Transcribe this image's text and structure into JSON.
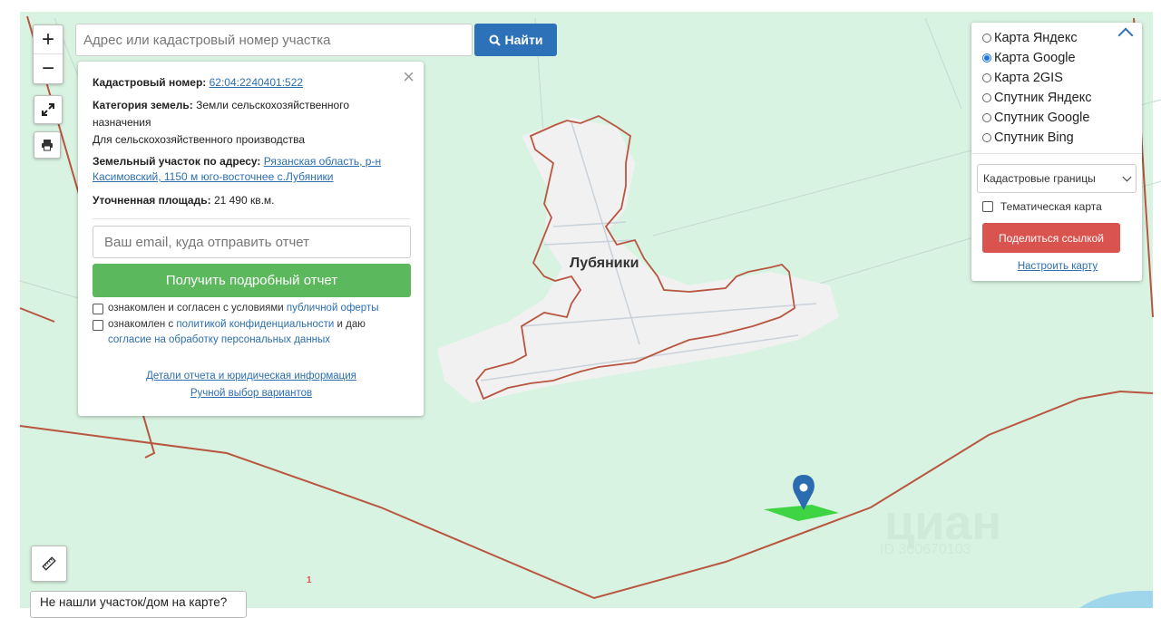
{
  "map": {
    "town_label": "Лубяники",
    "watermark": "циан",
    "watermark_id": "ID 300670103",
    "small_marker": "1"
  },
  "controls": {
    "zoom_in": "+",
    "zoom_out": "−"
  },
  "search": {
    "placeholder": "Адрес или кадастровый номер участка",
    "button_label": "Найти"
  },
  "info": {
    "cadastral_label": "Кадастровый номер:",
    "cadastral_number": "62:04:2240401:522",
    "category_label": "Категория земель:",
    "category_value": "Земли сельскохозяйственного назначения",
    "usage": "Для сельскохозяйственного производства",
    "address_label": "Земельный участок по адресу:",
    "address_value": "Рязанская область, р-н Касимовский, 1150 м юго-восточнее с.Лубяники",
    "area_label": "Уточненная площадь:",
    "area_value": "21 490 кв.м.",
    "email_placeholder": "Ваш email, куда отправить отчет",
    "report_button": "Получить подробный отчет",
    "offer_text": "ознакомлен и согласен с условиями",
    "offer_link": "публичной оферты",
    "privacy_text_1": "ознакомлен с",
    "privacy_link": "политикой конфиденциальности",
    "privacy_text_2": "и даю",
    "consent_link": "согласие на обработку персональных данных",
    "details_link": "Детали отчета и юридическая информация",
    "manual_link": "Ручной выбор вариантов"
  },
  "layers": {
    "options": [
      {
        "label": "Карта Яндекс",
        "selected": false
      },
      {
        "label": "Карта Google",
        "selected": true
      },
      {
        "label": "Карта 2GIS",
        "selected": false
      },
      {
        "label": "Спутник Яндекс",
        "selected": false
      },
      {
        "label": "Спутник Google",
        "selected": false
      },
      {
        "label": "Спутник Bing",
        "selected": false
      }
    ],
    "select_value": "Кадастровые границы",
    "thematic_label": "Тематическая карта",
    "share_button": "Поделиться ссылкой",
    "configure_link": "Настроить карту"
  },
  "bottom": {
    "not_found": "Не нашли участок/дом на карте?"
  },
  "colors": {
    "map_green": "#d9f3e2",
    "boundary": "#b8563f",
    "marker": "#2b6cb0",
    "plot": "#3ed444",
    "search_blue": "#2d72b8",
    "report_green": "#5cb85c",
    "share_red": "#d9534f",
    "link": "#2d6fae"
  }
}
